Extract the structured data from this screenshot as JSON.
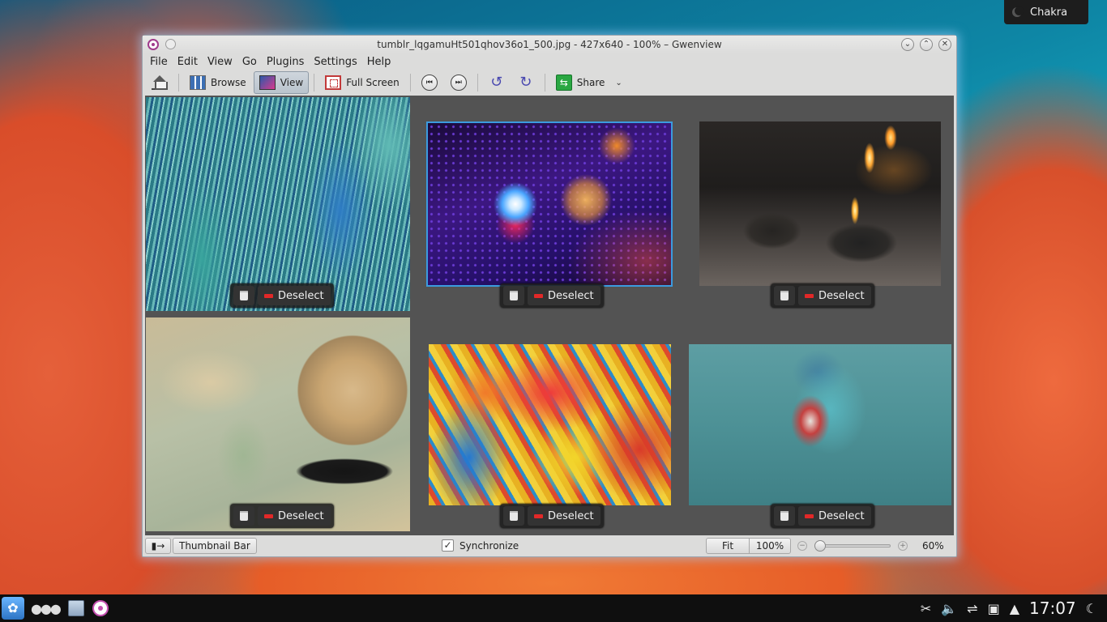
{
  "desktop": {
    "widget_label": "Chakra"
  },
  "window": {
    "title": "tumblr_lqgamuHt501qhov36o1_500.jpg - 427x640 - 100% – Gwenview",
    "buttons": {
      "minimize": "⌄",
      "maximize": "⌃",
      "close": "✕"
    }
  },
  "menubar": {
    "items": [
      {
        "label": "File"
      },
      {
        "label": "Edit"
      },
      {
        "label": "View"
      },
      {
        "label": "Go"
      },
      {
        "label": "Plugins"
      },
      {
        "label": "Settings"
      },
      {
        "label": "Help"
      }
    ]
  },
  "toolbar": {
    "browse_label": "Browse",
    "view_label": "View",
    "fullscreen_label": "Full Screen",
    "share_label": "Share",
    "prev_icon": "⏮",
    "next_icon": "⏭",
    "rotate_left_icon": "↺",
    "rotate_right_icon": "↻",
    "active_mode": "View"
  },
  "images": [
    {
      "deselect_label": "Deselect",
      "icon": "trash-icon",
      "current": false
    },
    {
      "deselect_label": "Deselect",
      "icon": "trash-icon",
      "current": true
    },
    {
      "deselect_label": "Deselect",
      "icon": "trash-icon",
      "current": false
    },
    {
      "deselect_label": "Deselect",
      "icon": "trash-icon",
      "current": false
    },
    {
      "deselect_label": "Deselect",
      "icon": "trash-icon",
      "current": false
    },
    {
      "deselect_label": "Deselect",
      "icon": "trash-icon",
      "current": false
    }
  ],
  "statusbar": {
    "toggle_icon": "▮→",
    "thumbnail_bar_label": "Thumbnail Bar",
    "synchronize_label": "Synchronize",
    "synchronize_checked": true,
    "fit_label": "Fit",
    "zoom_100_label": "100%",
    "zoom_percent": "60%",
    "zoom_slider_fraction": 0.05,
    "zoom_out_icon": "−",
    "zoom_in_icon": "+"
  },
  "taskbar": {
    "dots": "●●●",
    "clock": "17:07",
    "tray_icons": [
      "scissors-icon",
      "volume-icon",
      "usb-icon",
      "clipboard-icon",
      "arrow-up-icon"
    ]
  },
  "colors": {
    "accent": "#3b9bdf",
    "deselect_icon": "#e12828",
    "content_bg": "#535353"
  }
}
